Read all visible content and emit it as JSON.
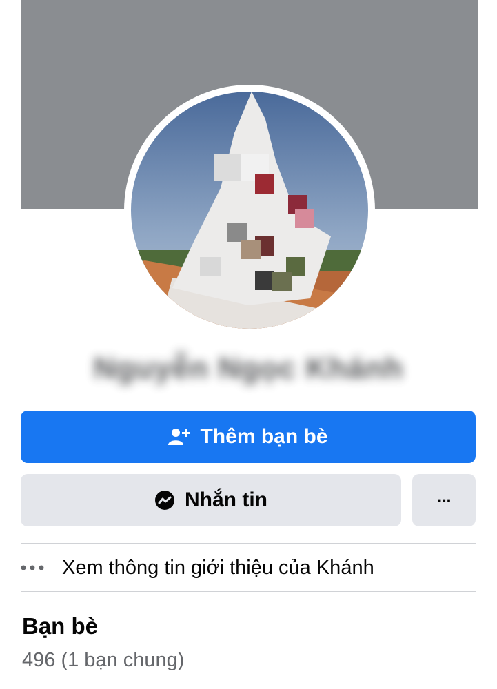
{
  "profile": {
    "name": "Nguyễn Ngọc Khánh"
  },
  "actions": {
    "add_friend_label": "Thêm bạn bè",
    "message_label": "Nhắn tin",
    "more_label": "···"
  },
  "about": {
    "label": "Xem thông tin giới thiệu của Khánh"
  },
  "friends": {
    "title": "Bạn bè",
    "count": "496 (1 bạn chung)"
  },
  "colors": {
    "primary": "#1877f2",
    "secondary_bg": "#e4e6eb",
    "cover": "#8a8d91",
    "muted_text": "#65676b"
  }
}
